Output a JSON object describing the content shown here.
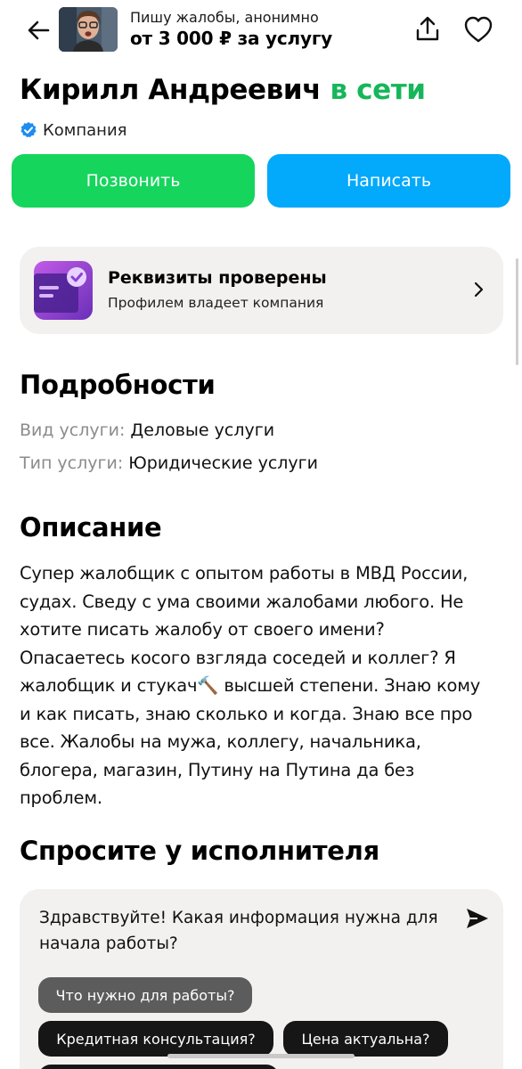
{
  "header": {
    "subtitle": "Пишу жалобы, анонимно",
    "price": "от 3 000 ₽ за услугу",
    "icons": {
      "back": "arrow-left-icon",
      "share": "share-icon",
      "favorite": "heart-icon"
    }
  },
  "seller": {
    "name": "Кирилл Андреевич",
    "status": "в сети",
    "type": "Компания"
  },
  "actions": {
    "call": "Позвонить",
    "message": "Написать"
  },
  "verified_card": {
    "title": "Реквизиты проверены",
    "subtitle": "Профилем владеет компания"
  },
  "details": {
    "heading": "Подробности",
    "rows": [
      {
        "key": "Вид услуги:",
        "value": "Деловые услуги"
      },
      {
        "key": "Тип услуги:",
        "value": "Юридические услуги"
      }
    ]
  },
  "description": {
    "heading": "Описание",
    "lines": [
      "Супер жалобщик с опытом работы в МВД России,",
      "судах. Сведу с ума своими жалобами любого. Не",
      "хотите писать жалобу от своего имени?",
      "Опасаетесь косого взгляда соседей и коллег? Я",
      "жалобщик и стукач🔨 высшей степени. Знаю кому",
      "и как писать, знаю сколько и когда. Знаю все про",
      "все. Жалобы на мужа, коллегу, начальника,",
      "блогера, магазин, Путину на Путина да без",
      "проблем."
    ]
  },
  "ask": {
    "heading": "Спросите у исполнителя",
    "message": "Здравствуйте! Какая информация нужна для начала работы?",
    "chips": [
      "Что нужно для работы?",
      "Кредитная консультация?",
      "Цена актуальна?",
      ""
    ]
  },
  "colors": {
    "online": "#16b65a",
    "call_button": "#15d55c",
    "message_button": "#03a9fb",
    "card_bg": "#f2f1f0",
    "verified_badge": "#1f8cf0",
    "verified_icon": "#8f3fd4"
  }
}
